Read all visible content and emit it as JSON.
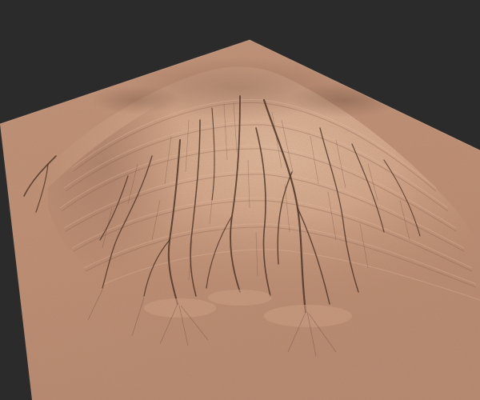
{
  "viewport": {
    "background_color": "#2b2b2b"
  },
  "terrain": {
    "material_color": "#c6957a",
    "highlight_color": "#e2b79b",
    "shadow_color": "#5a3a2c",
    "gully_color": "#3b2419"
  }
}
